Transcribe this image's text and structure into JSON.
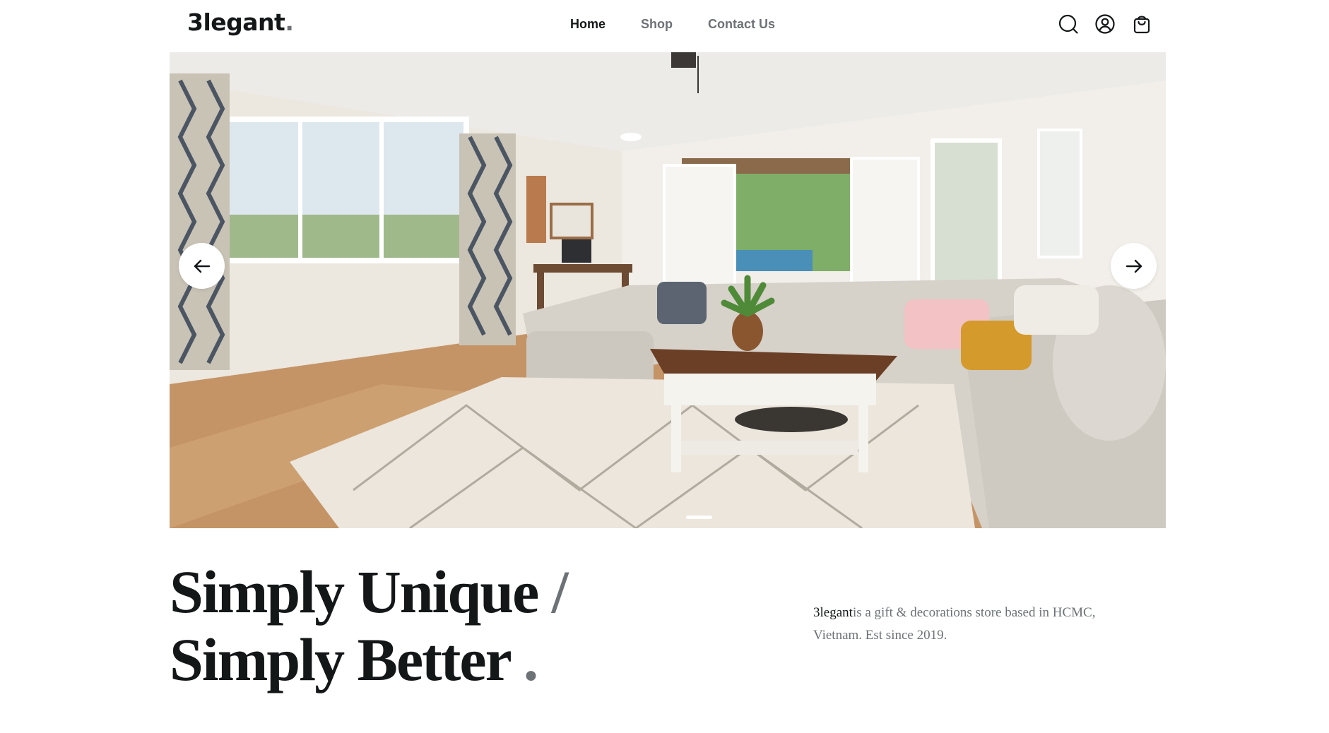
{
  "header": {
    "logo_text": "3legant",
    "logo_dot": ".",
    "nav": [
      {
        "label": "Home",
        "active": true
      },
      {
        "label": "Shop",
        "active": false
      },
      {
        "label": "Contact Us",
        "active": false
      }
    ],
    "icons": [
      "search-icon",
      "user-icon",
      "shopping-bag-icon"
    ]
  },
  "hero": {
    "prev_icon": "arrow-left-icon",
    "next_icon": "arrow-right-icon",
    "slide_count_visible": 1
  },
  "tagline": {
    "line1": "Simply Unique",
    "line1_sep": "/",
    "line2": "Simply Better",
    "line2_dot": "."
  },
  "description": {
    "brand": "3legant",
    "text": "is a gift & decorations store based in HCMC, Vietnam. Est since 2019."
  },
  "colors": {
    "primary": "#141718",
    "muted": "#6c7275",
    "background": "#ffffff"
  }
}
